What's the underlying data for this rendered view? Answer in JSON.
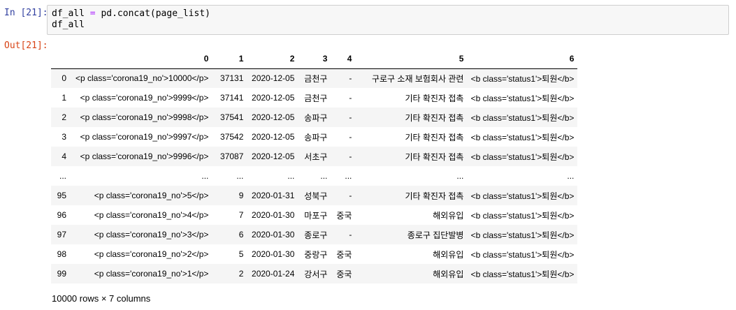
{
  "input_cell": {
    "prompt": "In [21]:",
    "code_line1_var": "df_all",
    "code_line1_op": "=",
    "code_line1_rhs": "pd.concat(page_list)",
    "code_line2": "df_all"
  },
  "output_cell": {
    "prompt": "Out[21]:"
  },
  "dataframe": {
    "columns": [
      "0",
      "1",
      "2",
      "3",
      "4",
      "5",
      "6"
    ],
    "rows": [
      {
        "index": "0",
        "cells": [
          "<p class='corona19_no'>10000</p>",
          "37131",
          "2020-12-05",
          "금천구",
          "-",
          "구로구 소재 보험회사 관련",
          "<b class='status1'>퇴원</b>"
        ]
      },
      {
        "index": "1",
        "cells": [
          "<p class='corona19_no'>9999</p>",
          "37141",
          "2020-12-05",
          "금천구",
          "-",
          "기타 확진자 접촉",
          "<b class='status1'>퇴원</b>"
        ]
      },
      {
        "index": "2",
        "cells": [
          "<p class='corona19_no'>9998</p>",
          "37541",
          "2020-12-05",
          "송파구",
          "-",
          "기타 확진자 접촉",
          "<b class='status1'>퇴원</b>"
        ]
      },
      {
        "index": "3",
        "cells": [
          "<p class='corona19_no'>9997</p>",
          "37542",
          "2020-12-05",
          "송파구",
          "-",
          "기타 확진자 접촉",
          "<b class='status1'>퇴원</b>"
        ]
      },
      {
        "index": "4",
        "cells": [
          "<p class='corona19_no'>9996</p>",
          "37087",
          "2020-12-05",
          "서초구",
          "-",
          "기타 확진자 접촉",
          "<b class='status1'>퇴원</b>"
        ]
      },
      {
        "index": "...",
        "cells": [
          "...",
          "...",
          "...",
          "...",
          "...",
          "...",
          "..."
        ]
      },
      {
        "index": "95",
        "cells": [
          "<p class='corona19_no'>5</p>",
          "9",
          "2020-01-31",
          "성북구",
          "-",
          "기타 확진자 접촉",
          "<b class='status1'>퇴원</b>"
        ]
      },
      {
        "index": "96",
        "cells": [
          "<p class='corona19_no'>4</p>",
          "7",
          "2020-01-30",
          "마포구",
          "중국",
          "해외유입",
          "<b class='status1'>퇴원</b>"
        ]
      },
      {
        "index": "97",
        "cells": [
          "<p class='corona19_no'>3</p>",
          "6",
          "2020-01-30",
          "종로구",
          "-",
          "종로구 집단발병",
          "<b class='status1'>퇴원</b>"
        ]
      },
      {
        "index": "98",
        "cells": [
          "<p class='corona19_no'>2</p>",
          "5",
          "2020-01-30",
          "중랑구",
          "중국",
          "해외유입",
          "<b class='status1'>퇴원</b>"
        ]
      },
      {
        "index": "99",
        "cells": [
          "<p class='corona19_no'>1</p>",
          "2",
          "2020-01-24",
          "강서구",
          "중국",
          "해외유입",
          "<b class='status1'>퇴원</b>"
        ]
      }
    ],
    "summary": "10000 rows × 7 columns"
  },
  "colors": {
    "in_prompt": "#303f9f",
    "out_prompt": "#d84315",
    "operator": "#aa22ff",
    "cell_background": "#f7f7f7",
    "stripe": "#f5f5f5"
  }
}
